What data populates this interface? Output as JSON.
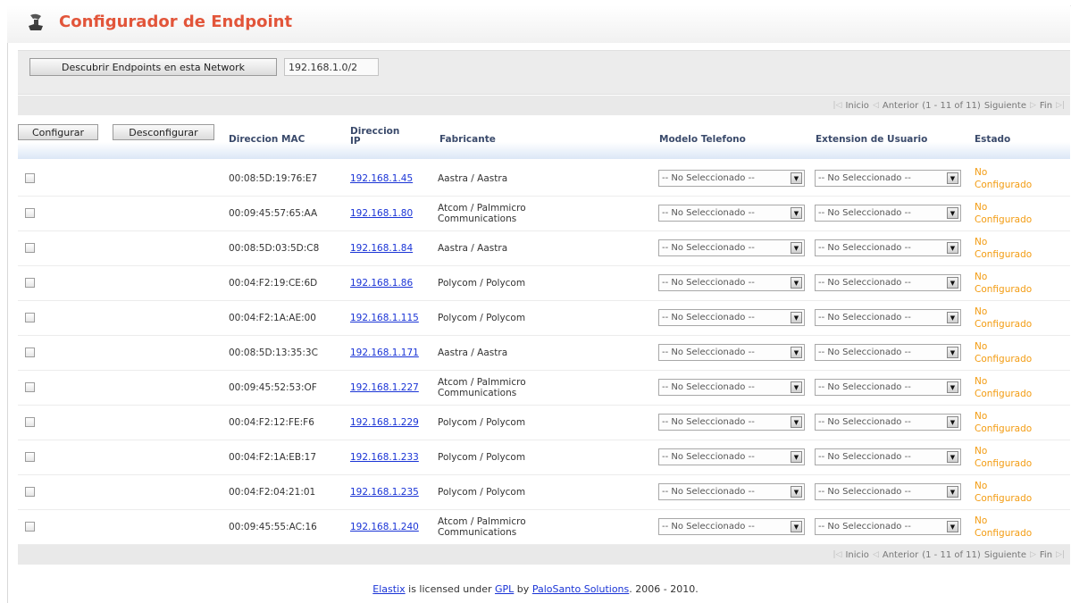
{
  "header": {
    "title": "Configurador de Endpoint",
    "icon": "phone-icon"
  },
  "discover": {
    "button_label": "Descubrir Endpoints en esta Network",
    "network_value": "192.168.1.0/2"
  },
  "pager": {
    "first": "Inicio",
    "prev": "Anterior",
    "range": "(1 - 11 of 11)",
    "next": "Siguiente",
    "last": "Fin"
  },
  "actions": {
    "configure_label": "Configurar",
    "unconfigure_label": "Desconfigurar"
  },
  "columns": {
    "mac": "Direccion MAC",
    "ip_line1": "Direccion",
    "ip_line2": "IP",
    "vendor": "Fabricante",
    "model": "Modelo Telefono",
    "extension": "Extension de Usuario",
    "status": "Estado"
  },
  "rows": [
    {
      "mac": "00:08:5D:19:76:E7",
      "ip": "192.168.1.45",
      "vendor_line1": "Aastra / Aastra",
      "vendor_line2": "",
      "model": "-- No Seleccionado --",
      "extension": "-- No Seleccionado --",
      "status_line1": "No",
      "status_line2": "Configurado"
    },
    {
      "mac": "00:09:45:57:65:AA",
      "ip": "192.168.1.80",
      "vendor_line1": "Atcom / Palmmicro",
      "vendor_line2": "Communications",
      "model": "-- No Seleccionado --",
      "extension": "-- No Seleccionado --",
      "status_line1": "No",
      "status_line2": "Configurado"
    },
    {
      "mac": "00:08:5D:03:5D:C8",
      "ip": "192.168.1.84",
      "vendor_line1": "Aastra / Aastra",
      "vendor_line2": "",
      "model": "-- No Seleccionado --",
      "extension": "-- No Seleccionado --",
      "status_line1": "No",
      "status_line2": "Configurado"
    },
    {
      "mac": "00:04:F2:19:CE:6D",
      "ip": "192.168.1.86",
      "vendor_line1": "Polycom / Polycom",
      "vendor_line2": "",
      "model": "-- No Seleccionado --",
      "extension": "-- No Seleccionado --",
      "status_line1": "No",
      "status_line2": "Configurado"
    },
    {
      "mac": "00:04:F2:1A:AE:00",
      "ip": "192.168.1.115",
      "vendor_line1": "Polycom / Polycom",
      "vendor_line2": "",
      "model": "-- No Seleccionado --",
      "extension": "-- No Seleccionado --",
      "status_line1": "No",
      "status_line2": "Configurado"
    },
    {
      "mac": "00:08:5D:13:35:3C",
      "ip": "192.168.1.171",
      "vendor_line1": "Aastra / Aastra",
      "vendor_line2": "",
      "model": "-- No Seleccionado --",
      "extension": "-- No Seleccionado --",
      "status_line1": "No",
      "status_line2": "Configurado"
    },
    {
      "mac": "00:09:45:52:53:OF",
      "ip": "192.168.1.227",
      "vendor_line1": "Atcom / Palmmicro",
      "vendor_line2": "Communications",
      "model": "-- No Seleccionado --",
      "extension": "-- No Seleccionado --",
      "status_line1": "No",
      "status_line2": "Configurado"
    },
    {
      "mac": "00:04:F2:12:FE:F6",
      "ip": "192.168.1.229",
      "vendor_line1": "Polycom / Polycom",
      "vendor_line2": "",
      "model": "-- No Seleccionado --",
      "extension": "-- No Seleccionado --",
      "status_line1": "No",
      "status_line2": "Configurado"
    },
    {
      "mac": "00:04:F2:1A:EB:17",
      "ip": "192.168.1.233",
      "vendor_line1": "Polycom / Polycom",
      "vendor_line2": "",
      "model": "-- No Seleccionado --",
      "extension": "-- No Seleccionado --",
      "status_line1": "No",
      "status_line2": "Configurado"
    },
    {
      "mac": "00:04:F2:04:21:01",
      "ip": "192.168.1.235",
      "vendor_line1": "Polycom / Polycom",
      "vendor_line2": "",
      "model": "-- No Seleccionado --",
      "extension": "-- No Seleccionado --",
      "status_line1": "No",
      "status_line2": "Configurado"
    },
    {
      "mac": "00:09:45:55:AC:16",
      "ip": "192.168.1.240",
      "vendor_line1": "Atcom / Palmmicro",
      "vendor_line2": "Communications",
      "model": "-- No Seleccionado --",
      "extension": "-- No Seleccionado --",
      "status_line1": "No",
      "status_line2": "Configurado"
    }
  ],
  "footer": {
    "elastix_link": "Elastix",
    "text1": " is licensed under ",
    "gpl_link": "GPL",
    "text2": " by ",
    "palosanto_link": "PaloSanto Solutions",
    "text3": ". 2006 - 2010."
  },
  "colors": {
    "title": "#e2553a",
    "status": "#f39c12",
    "link": "#1a34d6",
    "header_text": "#3a4a6b"
  }
}
